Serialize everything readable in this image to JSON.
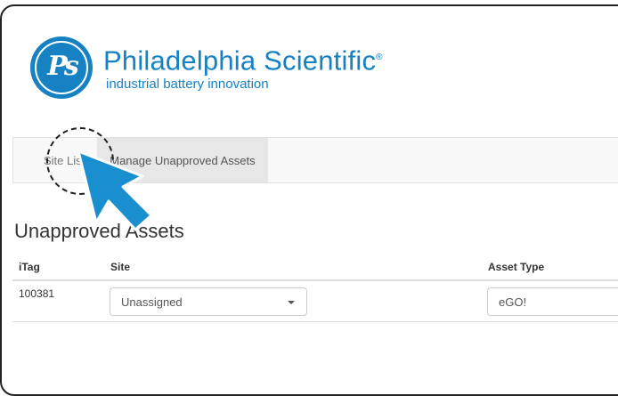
{
  "brand": {
    "name": "Philadelphia Scientific",
    "registered": "®",
    "tagline": "industrial battery innovation",
    "monogram": "Ps",
    "color": "#1681c3"
  },
  "nav": {
    "items": [
      {
        "label": "Site List"
      },
      {
        "label": "Manage Unapproved Assets",
        "active": true
      }
    ]
  },
  "page": {
    "title": "Unapproved Assets"
  },
  "table": {
    "headers": {
      "itag": "iTag",
      "site": "Site",
      "asset_type": "Asset Type"
    },
    "rows": [
      {
        "itag": "100381",
        "site": "Unassigned",
        "asset_type": "eGO!"
      }
    ]
  },
  "annotation": {
    "pointer_color": "#1a8fd0",
    "pointer_outline": "#ffffff",
    "icon": "cursor-arrow-icon"
  }
}
